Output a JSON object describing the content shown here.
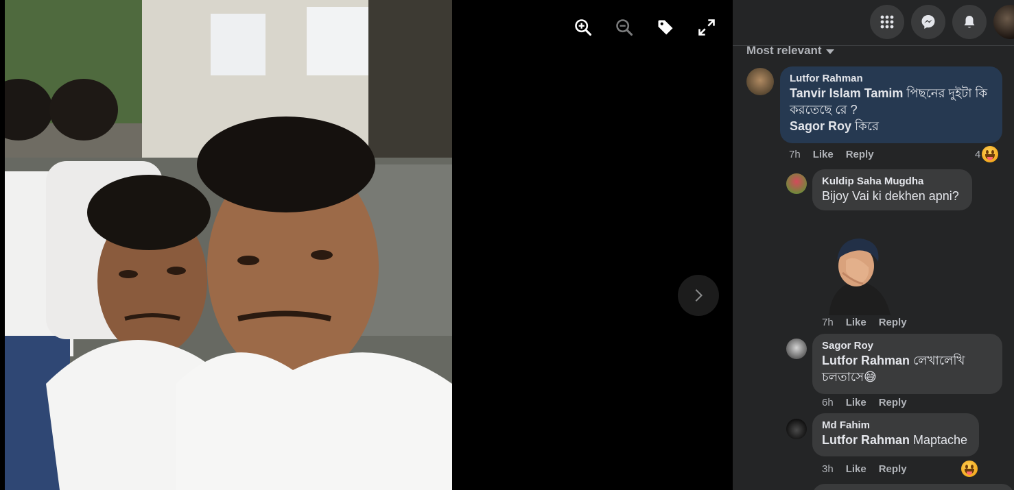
{
  "viewer": {
    "tools": [
      {
        "name": "zoom-in-icon"
      },
      {
        "name": "zoom-out-icon"
      },
      {
        "name": "tag-icon"
      },
      {
        "name": "fullscreen-icon"
      }
    ],
    "next_icon": "chevron-right-icon"
  },
  "topbar": {
    "icons": [
      "menu-grid-icon",
      "messenger-icon",
      "notifications-icon",
      "account-avatar"
    ]
  },
  "sort": {
    "label": "Most relevant"
  },
  "comments": [
    {
      "author": "Lutfor Rahman",
      "segments": [
        {
          "mention": "Tanvir Islam Tamim",
          "text": " পিছনের দুইটা কি করতেছে রে ?"
        },
        {
          "mention": "Sagor Roy",
          "text": " কিরে"
        }
      ],
      "time": "7h",
      "like": "Like",
      "reply": "Reply",
      "reactions": "4"
    },
    {
      "author": "Kuldip Saha Mugdha",
      "segments": [
        {
          "mention": "",
          "text": "Bijoy Vai ki dekhen apni?"
        }
      ],
      "sticker": "facepalm-avatar-sticker",
      "time": "7h",
      "like": "Like",
      "reply": "Reply"
    },
    {
      "author": "Sagor Roy",
      "segments": [
        {
          "mention": "Lutfor Rahman",
          "text": " লেখালেখি চলতাসে😅"
        }
      ],
      "time": "6h",
      "like": "Like",
      "reply": "Reply"
    },
    {
      "author": "Md Fahim",
      "segments": [
        {
          "mention": "Lutfor Rahman",
          "text": " Maptache"
        }
      ],
      "time": "3h",
      "like": "Like",
      "reply": "Reply"
    }
  ],
  "colors": {
    "panel_bg": "#242526",
    "bubble": "#3a3b3c",
    "bubble_highlight": "#263951",
    "text": "#e4e6eb",
    "secondary_text": "#b0b3b8"
  }
}
